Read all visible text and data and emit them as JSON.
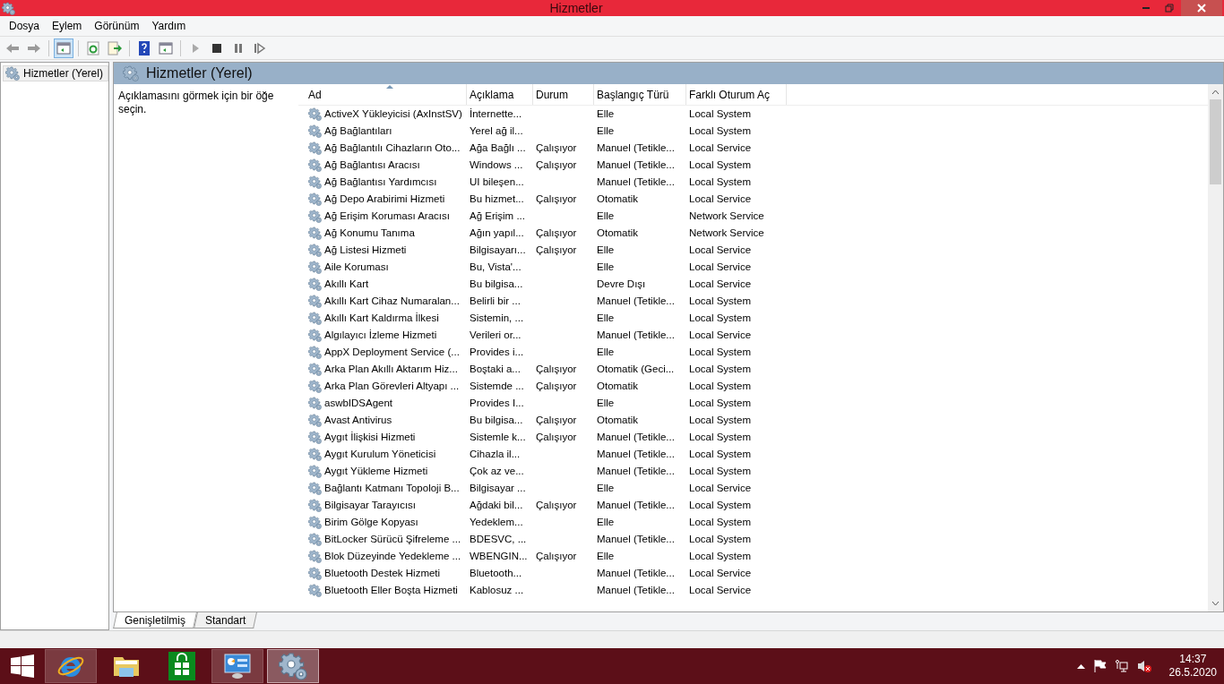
{
  "window": {
    "title": "Hizmetler"
  },
  "menu": [
    "Dosya",
    "Eylem",
    "Görünüm",
    "Yardım"
  ],
  "toolbar": [
    {
      "kind": "back",
      "pressed": false
    },
    {
      "kind": "forward",
      "pressed": false
    },
    {
      "kind": "sep"
    },
    {
      "kind": "tree",
      "pressed": true
    },
    {
      "kind": "sep"
    },
    {
      "kind": "refresh",
      "pressed": false
    },
    {
      "kind": "export",
      "pressed": false
    },
    {
      "kind": "sep"
    },
    {
      "kind": "help",
      "pressed": false
    },
    {
      "kind": "view",
      "pressed": false
    },
    {
      "kind": "sep"
    },
    {
      "kind": "play",
      "pressed": false
    },
    {
      "kind": "stop",
      "pressed": false
    },
    {
      "kind": "pause",
      "pressed": false
    },
    {
      "kind": "resume",
      "pressed": false
    }
  ],
  "tree": {
    "items": [
      {
        "label": "Hizmetler (Yerel)",
        "selected": true
      }
    ]
  },
  "panel": {
    "title": "Hizmetler (Yerel)",
    "description": "Açıklamasını görmek için bir öğe seçin."
  },
  "table": {
    "columns": [
      {
        "label": "Ad",
        "sorted": true
      },
      {
        "label": "Açıklama",
        "sorted": false
      },
      {
        "label": "Durum",
        "sorted": false
      },
      {
        "label": "Başlangıç Türü",
        "sorted": false
      },
      {
        "label": "Farklı Oturum Aç",
        "sorted": false
      }
    ],
    "rows": [
      [
        "ActiveX Yükleyicisi (AxInstSV)",
        "İnternette...",
        "",
        "Elle",
        "Local System"
      ],
      [
        "Ağ Bağlantıları",
        "Yerel ağ il...",
        "",
        "Elle",
        "Local System"
      ],
      [
        "Ağ Bağlantılı Cihazların Oto...",
        "Ağa Bağlı ...",
        "Çalışıyor",
        "Manuel (Tetikle...",
        "Local Service"
      ],
      [
        "Ağ Bağlantısı Aracısı",
        "Windows ...",
        "Çalışıyor",
        "Manuel (Tetikle...",
        "Local System"
      ],
      [
        "Ağ Bağlantısı Yardımcısı",
        "UI bileşen...",
        "",
        "Manuel (Tetikle...",
        "Local System"
      ],
      [
        "Ağ Depo Arabirimi Hizmeti",
        "Bu hizmet...",
        "Çalışıyor",
        "Otomatik",
        "Local Service"
      ],
      [
        "Ağ Erişim Koruması Aracısı",
        "Ağ Erişim ...",
        "",
        "Elle",
        "Network Service"
      ],
      [
        "Ağ Konumu Tanıma",
        "Ağın yapıl...",
        "Çalışıyor",
        "Otomatik",
        "Network Service"
      ],
      [
        "Ağ Listesi Hizmeti",
        "Bilgisayarı...",
        "Çalışıyor",
        "Elle",
        "Local Service"
      ],
      [
        "Aile Koruması",
        "Bu, Vista'...",
        "",
        "Elle",
        "Local Service"
      ],
      [
        "Akıllı Kart",
        "Bu bilgisa...",
        "",
        "Devre Dışı",
        "Local Service"
      ],
      [
        "Akıllı Kart Cihaz Numaralan...",
        "Belirli bir ...",
        "",
        "Manuel (Tetikle...",
        "Local System"
      ],
      [
        "Akıllı Kart Kaldırma İlkesi",
        "Sistemin, ...",
        "",
        "Elle",
        "Local System"
      ],
      [
        "Algılayıcı İzleme Hizmeti",
        "Verileri or...",
        "",
        "Manuel (Tetikle...",
        "Local Service"
      ],
      [
        "AppX Deployment Service (...",
        "Provides i...",
        "",
        "Elle",
        "Local System"
      ],
      [
        "Arka Plan Akıllı Aktarım Hiz...",
        "Boştaki a...",
        "Çalışıyor",
        "Otomatik (Geci...",
        "Local System"
      ],
      [
        "Arka Plan Görevleri Altyapı ...",
        "Sistemde ...",
        "Çalışıyor",
        "Otomatik",
        "Local System"
      ],
      [
        "aswbIDSAgent",
        "Provides I...",
        "",
        "Elle",
        "Local System"
      ],
      [
        "Avast Antivirus",
        "Bu bilgisa...",
        "Çalışıyor",
        "Otomatik",
        "Local System"
      ],
      [
        "Aygıt İlişkisi Hizmeti",
        "Sistemle k...",
        "Çalışıyor",
        "Manuel (Tetikle...",
        "Local System"
      ],
      [
        "Aygıt Kurulum Yöneticisi",
        "Cihazla il...",
        "",
        "Manuel (Tetikle...",
        "Local System"
      ],
      [
        "Aygıt Yükleme Hizmeti",
        "Çok az ve...",
        "",
        "Manuel (Tetikle...",
        "Local System"
      ],
      [
        "Bağlantı Katmanı Topoloji B...",
        "Bilgisayar ...",
        "",
        "Elle",
        "Local Service"
      ],
      [
        "Bilgisayar Tarayıcısı",
        "Ağdaki bil...",
        "Çalışıyor",
        "Manuel (Tetikle...",
        "Local System"
      ],
      [
        "Birim Gölge Kopyası",
        "Yedeklem...",
        "",
        "Elle",
        "Local System"
      ],
      [
        "BitLocker Sürücü Şifreleme ...",
        "BDESVC, ...",
        "",
        "Manuel (Tetikle...",
        "Local System"
      ],
      [
        "Blok Düzeyinde Yedekleme ...",
        "WBENGIN...",
        "Çalışıyor",
        "Elle",
        "Local System"
      ],
      [
        "Bluetooth Destek Hizmeti",
        "Bluetooth...",
        "",
        "Manuel (Tetikle...",
        "Local Service"
      ],
      [
        "Bluetooth Eller Boşta Hizmeti",
        "Kablosuz ...",
        "",
        "Manuel (Tetikle...",
        "Local Service"
      ]
    ]
  },
  "tabs": [
    {
      "label": "Genişletilmiş",
      "selected": true
    },
    {
      "label": "Standart",
      "selected": false
    }
  ],
  "taskbar": {
    "apps": [
      {
        "kind": "browser",
        "open": true,
        "selected": false
      },
      {
        "kind": "folder",
        "open": false,
        "selected": false
      },
      {
        "kind": "store",
        "open": false,
        "selected": false
      },
      {
        "kind": "panel",
        "open": true,
        "selected": false
      },
      {
        "kind": "gears",
        "open": true,
        "selected": true
      }
    ],
    "time": "14:37",
    "date": "26.5.2020"
  }
}
